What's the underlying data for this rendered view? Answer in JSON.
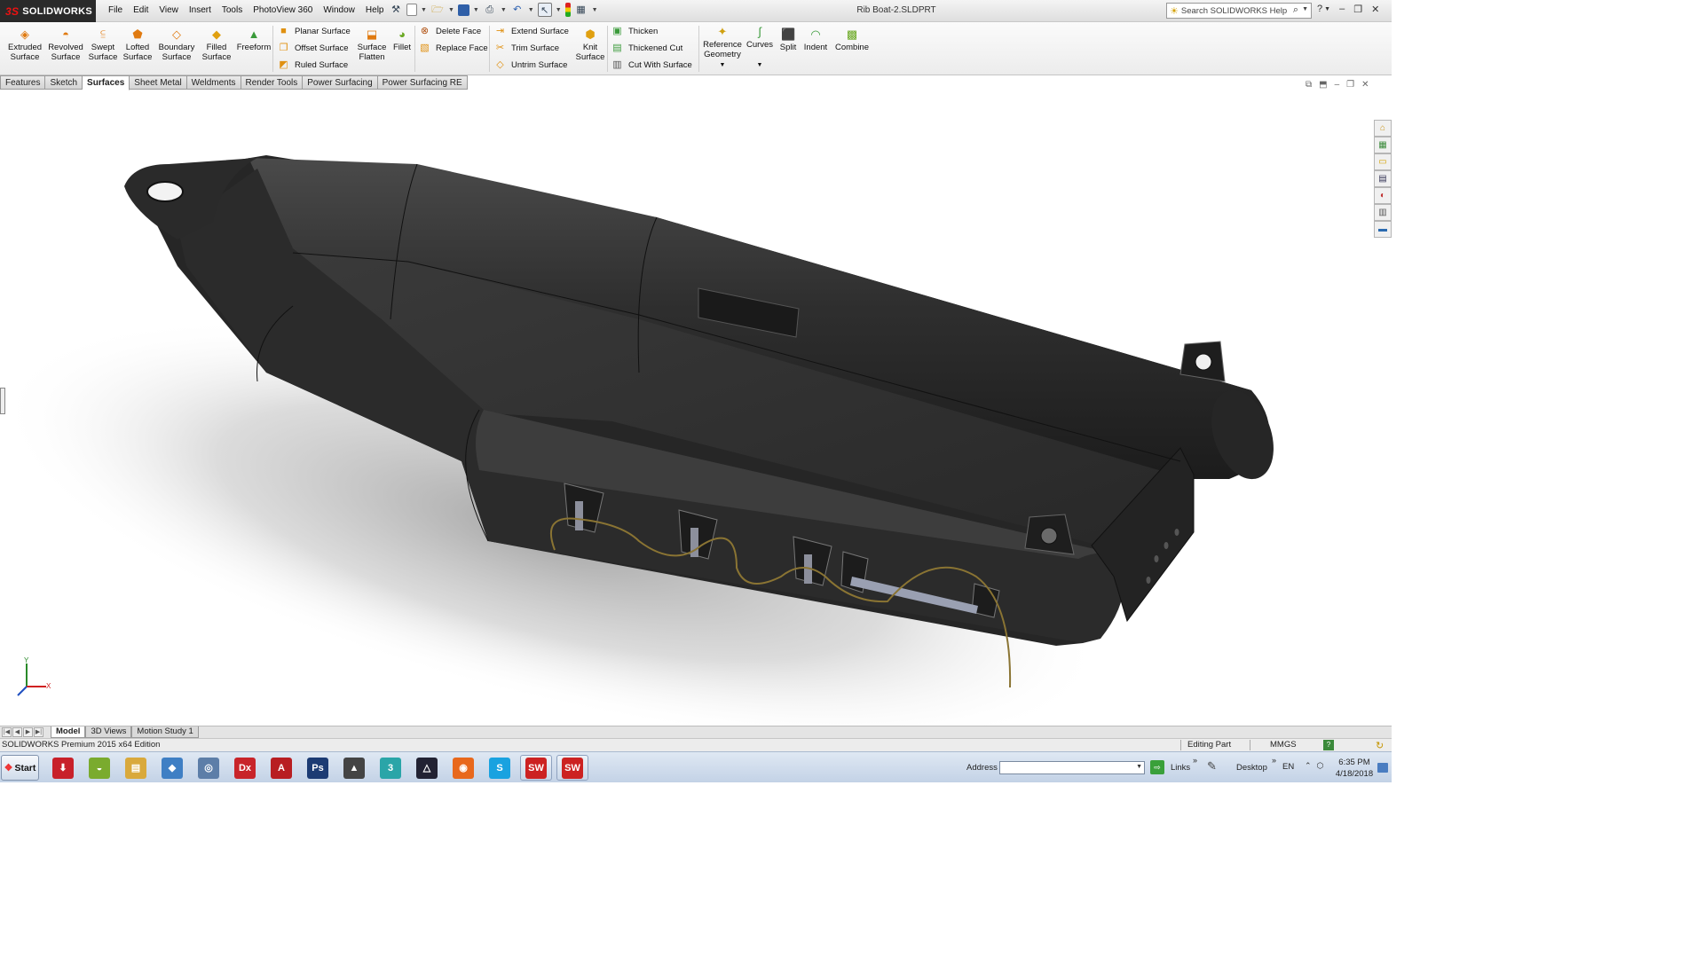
{
  "app": {
    "brand": "SOLIDWORKS",
    "document_title": "Rib Boat-2.SLDPRT"
  },
  "menu": [
    "File",
    "Edit",
    "View",
    "Insert",
    "Tools",
    "PhotoView 360",
    "Window",
    "Help"
  ],
  "search": {
    "placeholder": "Search SOLIDWORKS Help"
  },
  "ribbon": {
    "large_buttons": [
      {
        "label": "Extruded\nSurface",
        "icon": "extruded-surface-icon"
      },
      {
        "label": "Revolved\nSurface",
        "icon": "revolved-surface-icon"
      },
      {
        "label": "Swept\nSurface",
        "icon": "swept-surface-icon"
      },
      {
        "label": "Lofted\nSurface",
        "icon": "lofted-surface-icon"
      },
      {
        "label": "Boundary\nSurface",
        "icon": "boundary-surface-icon"
      },
      {
        "label": "Filled\nSurface",
        "icon": "filled-surface-icon"
      },
      {
        "label": "Freeform",
        "icon": "freeform-icon"
      }
    ],
    "group1": [
      "Planar Surface",
      "Offset Surface",
      "Ruled Surface"
    ],
    "surface_flatten": "Surface\nFlatten",
    "fillet": "Fillet",
    "group2": [
      "Delete Face",
      "Replace Face"
    ],
    "group3": [
      "Extend Surface",
      "Trim Surface",
      "Untrim Surface"
    ],
    "knit_surface": "Knit\nSurface",
    "group4": [
      "Thicken",
      "Thickened Cut",
      "Cut With Surface"
    ],
    "reference_geometry": "Reference\nGeometry",
    "curves": "Curves",
    "split": "Split",
    "indent": "Indent",
    "combine": "Combine"
  },
  "tabs": [
    {
      "label": "Features",
      "active": false
    },
    {
      "label": "Sketch",
      "active": false
    },
    {
      "label": "Surfaces",
      "active": true
    },
    {
      "label": "Sheet Metal",
      "active": false
    },
    {
      "label": "Weldments",
      "active": false
    },
    {
      "label": "Render Tools",
      "active": false
    },
    {
      "label": "Power Surfacing",
      "active": false
    },
    {
      "label": "Power Surfacing RE",
      "active": false
    }
  ],
  "triad": {
    "x": "X",
    "y": "Y"
  },
  "model_tabs": [
    {
      "label": "Model",
      "active": true
    },
    {
      "label": "3D Views",
      "active": false
    },
    {
      "label": "Motion Study 1",
      "active": false
    }
  ],
  "status": {
    "edition": "SOLIDWORKS Premium 2015 x64 Edition",
    "mode": "Editing Part",
    "units": "MMGS"
  },
  "taskbar": {
    "start_label": "Start",
    "apps": [
      {
        "name": "download-app",
        "glyph": "⬇",
        "color": "#c8202a"
      },
      {
        "name": "app-green",
        "glyph": "◒",
        "color": "#7aab2e"
      },
      {
        "name": "file-explorer",
        "glyph": "▤",
        "color": "#d9a93c"
      },
      {
        "name": "app-blue-diamond",
        "glyph": "◆",
        "color": "#3f7fc4"
      },
      {
        "name": "app-spiral",
        "glyph": "◎",
        "color": "#5d7ea8"
      },
      {
        "name": "dx-app",
        "glyph": "Dx",
        "color": "#c8242a"
      },
      {
        "name": "acrobat",
        "glyph": "A",
        "color": "#b81e22"
      },
      {
        "name": "photoshop",
        "glyph": "Ps",
        "color": "#1c3b73"
      },
      {
        "name": "app-rhino",
        "glyph": "▲",
        "color": "#444444"
      },
      {
        "name": "app-3",
        "glyph": "3",
        "color": "#2aa5a8"
      },
      {
        "name": "app-triangle",
        "glyph": "△",
        "color": "#222233"
      },
      {
        "name": "firefox",
        "glyph": "◉",
        "color": "#e8681c"
      },
      {
        "name": "skype",
        "glyph": "S",
        "color": "#19a2e0"
      },
      {
        "name": "solidworks-2015-a",
        "glyph": "SW",
        "color": "#cc2222"
      },
      {
        "name": "solidworks-2015-b",
        "glyph": "SW",
        "color": "#cc2222"
      }
    ],
    "address_label": "Address",
    "links_label": "Links",
    "desktop_label": "Desktop",
    "lang": "EN",
    "time": "6:35 PM",
    "date": "4/18/2018"
  }
}
